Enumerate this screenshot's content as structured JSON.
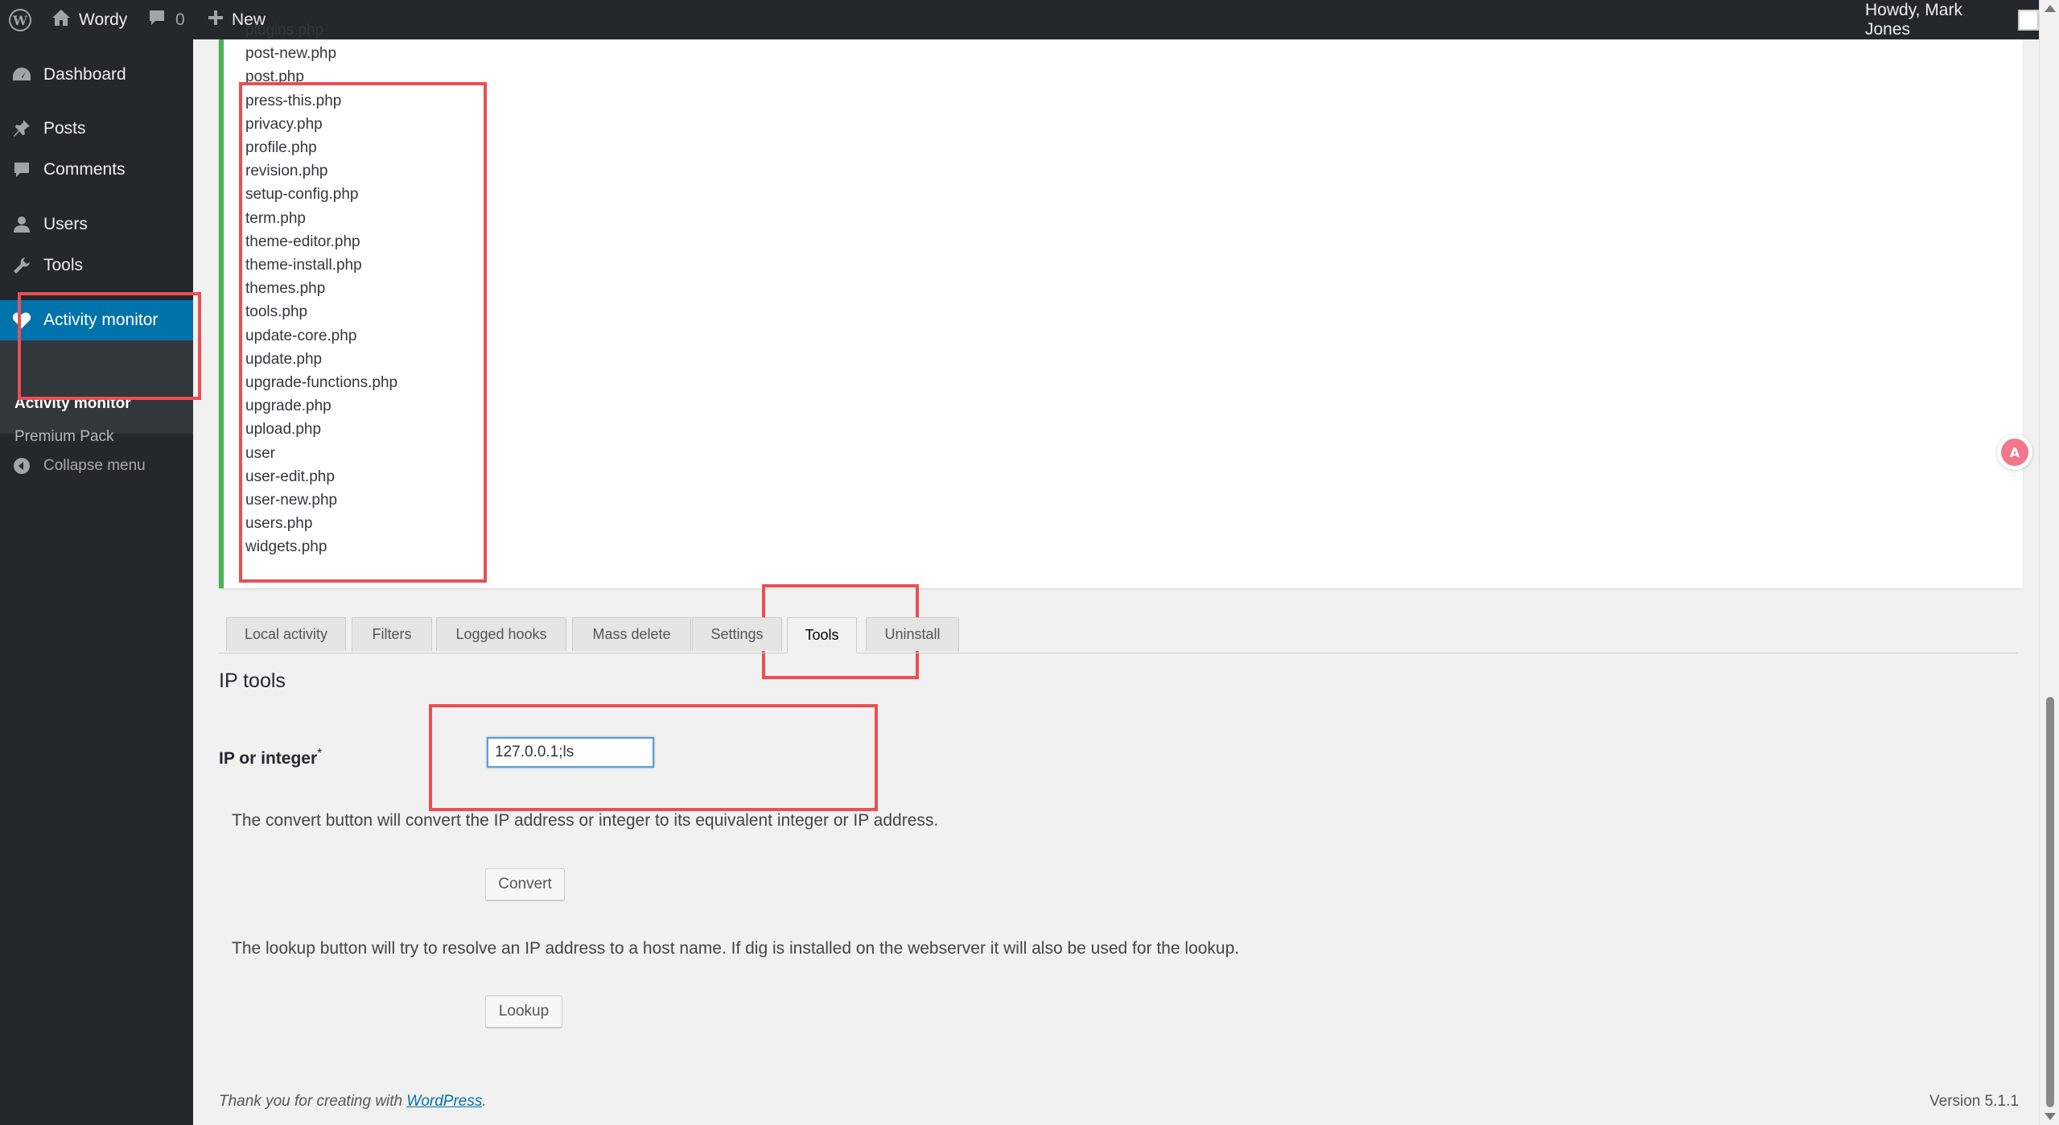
{
  "adminbar": {
    "site_name": "Wordy",
    "comment_count": "0",
    "new_label": "New",
    "howdy": "Howdy, Mark Jones"
  },
  "sidebar": {
    "items": [
      {
        "label": "Dashboard",
        "icon": "dashboard-icon"
      },
      {
        "label": "Posts",
        "icon": "pin-icon"
      },
      {
        "label": "Comments",
        "icon": "comment-icon"
      },
      {
        "label": "Users",
        "icon": "user-icon"
      },
      {
        "label": "Tools",
        "icon": "wrench-icon"
      },
      {
        "label": "Activity monitor",
        "icon": "heart-icon"
      }
    ],
    "submenu": [
      "Activity monitor",
      "Premium Pack"
    ],
    "collapse": "Collapse menu"
  },
  "files": [
    "plugins.php",
    "post-new.php",
    "post.php",
    "press-this.php",
    "privacy.php",
    "profile.php",
    "revision.php",
    "setup-config.php",
    "term.php",
    "theme-editor.php",
    "theme-install.php",
    "themes.php",
    "tools.php",
    "update-core.php",
    "update.php",
    "upgrade-functions.php",
    "upgrade.php",
    "upload.php",
    "user",
    "user-edit.php",
    "user-new.php",
    "users.php",
    "widgets.php"
  ],
  "tabs": [
    "Local activity",
    "Filters",
    "Logged hooks",
    "Mass delete",
    "Settings",
    "Tools",
    "Uninstall"
  ],
  "active_tab": "Tools",
  "section_title": "IP tools",
  "ip_label": "IP or integer",
  "required_mark": "*",
  "ip_value": "127.0.0.1;ls",
  "convert_desc": "The convert button will convert the IP address or integer to its equivalent integer or IP address.",
  "convert_button": "Convert",
  "lookup_desc": "The lookup button will try to resolve an IP address to a host name. If dig is installed on the webserver it will also be used for the lookup.",
  "lookup_button": "Lookup",
  "footer": {
    "thanks_prefix": "Thank you for creating with ",
    "wordpress_link": "WordPress",
    "thanks_suffix": ".",
    "version": "Version 5.1.1"
  },
  "colors": {
    "adminbar_bg": "#23282d",
    "accent": "#0073aa",
    "success_border": "#46b450",
    "highlight_red": "#ea4f55"
  }
}
